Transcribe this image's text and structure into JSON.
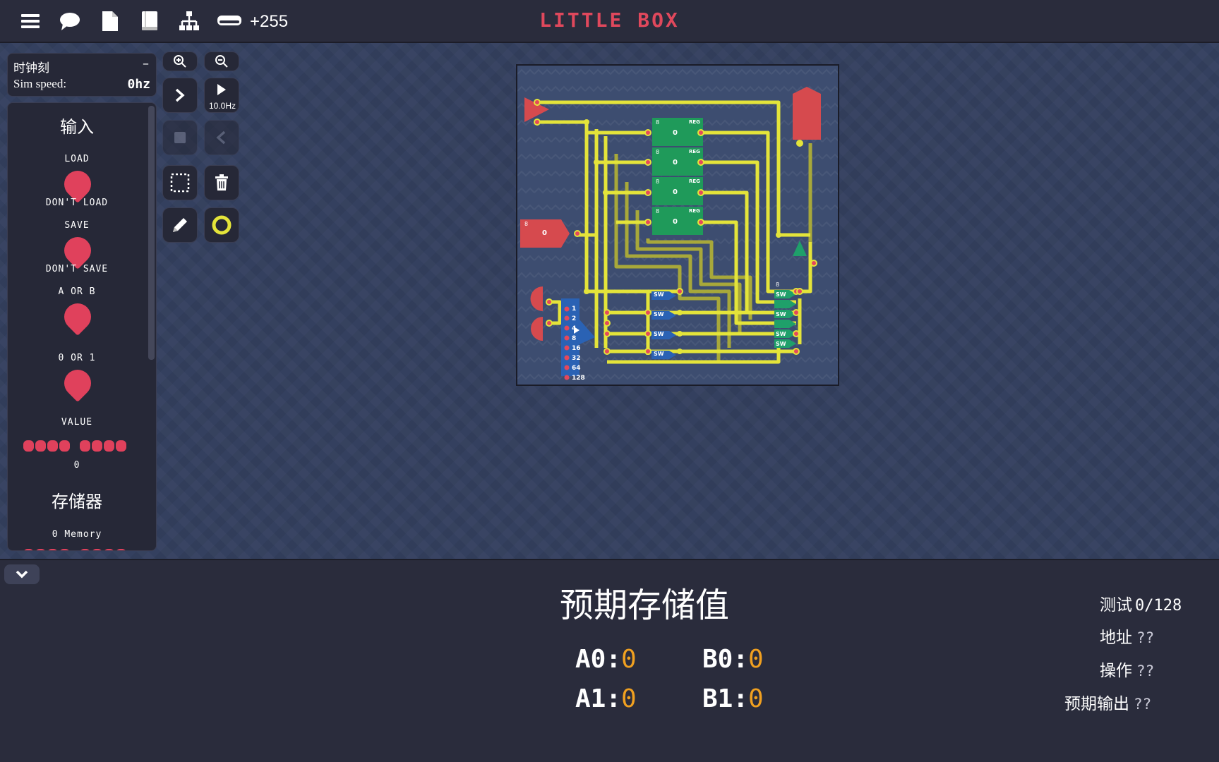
{
  "topbar": {
    "title": "LITTLE BOX",
    "score": "+255",
    "icons": [
      "menu-icon",
      "chat-icon",
      "file-icon",
      "book-icon",
      "hierarchy-icon",
      "tape-icon"
    ]
  },
  "sim": {
    "clock_label": "时钟刻",
    "collapse": "–",
    "speed_label": "Sim speed:",
    "speed_value": "0hz"
  },
  "io": {
    "inputs_heading": "输入",
    "load_label": "LOAD",
    "load_state": "DON'T LOAD",
    "save_label": "SAVE",
    "save_state": "DON'T SAVE",
    "a_or_b_label": "A OR B",
    "zero_or_one_label": "0 OR 1",
    "value_label": "VALUE",
    "value": "0",
    "memory_heading": "存储器",
    "memory_label": "0 Memory"
  },
  "tools": {
    "play_speed": "10.0Hz"
  },
  "board": {
    "registers": [
      {
        "bits": "8",
        "tag": "REG",
        "value": "0"
      },
      {
        "bits": "8",
        "tag": "REG",
        "value": "0"
      },
      {
        "bits": "8",
        "tag": "REG",
        "value": "0"
      },
      {
        "bits": "8",
        "tag": "REG",
        "value": "0"
      }
    ],
    "input_byte": {
      "bits": "8",
      "value": "0"
    },
    "decoder_labels": [
      "1",
      "2",
      "4",
      "8",
      "16",
      "32",
      "64",
      "128"
    ],
    "switch_label": "SW",
    "output_bits": "8"
  },
  "expected": {
    "title": "预期存储值",
    "a0_label": "A0:",
    "a0_value": "0",
    "b0_label": "B0:",
    "b0_value": "0",
    "a1_label": "A1:",
    "a1_value": "0",
    "b1_label": "B1:",
    "b1_value": "0"
  },
  "test_info": {
    "test_label": "测试",
    "test_value": "0/128",
    "address_label": "地址",
    "address_value": "??",
    "operation_label": "操作",
    "operation_value": "??",
    "expected_output_label": "预期输出",
    "expected_output_value": "??"
  },
  "colors": {
    "accent": "#e0485c",
    "wire": "#e4e43a",
    "register": "#1f9a5a",
    "value": "#f0a020"
  }
}
